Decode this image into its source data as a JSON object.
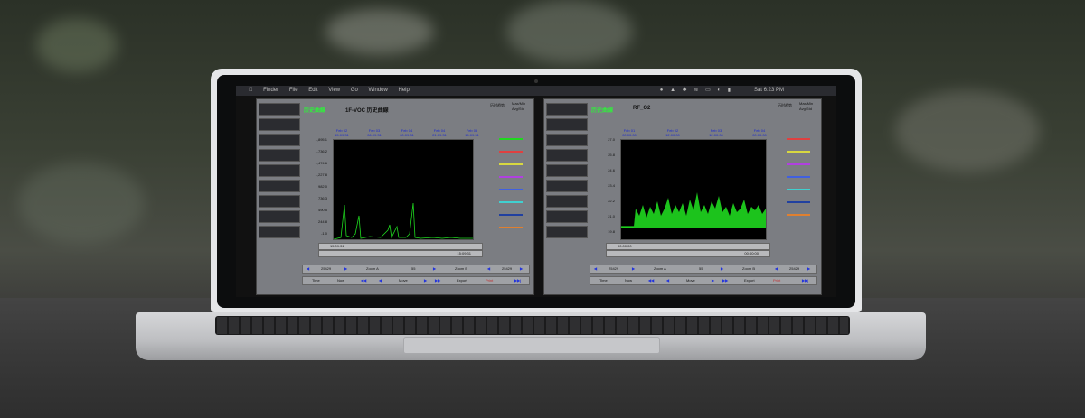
{
  "menubar": {
    "app": "Finder",
    "items": [
      "File",
      "Edit",
      "View",
      "Go",
      "Window",
      "Help"
    ],
    "clock": "Sat 6:23 PM"
  },
  "window_left": {
    "title_cn": "历史曲線",
    "title": "1F-VOC 历史曲線",
    "option_1": "历时趋势",
    "option_2": "Max/Min",
    "option_3": "Avg/Std",
    "dates": [
      "Feb 02\n15:09:31",
      "Feb 03\n06:09:31",
      "Feb 04\n00:09:31",
      "Feb 04\n21:09:31",
      "Feb 05\n15:09:31"
    ],
    "yticks": [
      "1,895.1",
      "1,736.2",
      "1,474.6",
      "1,227.8",
      "982.0",
      "736.3",
      "490.5",
      "244.8",
      "-1.0"
    ],
    "scroll_time_left": "15:09:31",
    "scroll_time_right": "15:09:31",
    "nav": {
      "left_val": "25429",
      "zoom_a": "Zoom A",
      "mid": "55",
      "zoom_b": "Zoom B",
      "right_val": "25429"
    },
    "buttons": {
      "b1": "Time",
      "b2": "Now",
      "b3": "Move",
      "b4": "Export",
      "b5": "Print"
    }
  },
  "window_right": {
    "title_cn": "历史曲線",
    "title": "RF_O2",
    "option_1": "历时趋势",
    "option_2": "Max/Min",
    "option_3": "Avg/Std",
    "dates": [
      "Feb 01\n00:00:00",
      "Feb 02\n12:00:00",
      "Feb 03\n12:00:00",
      "Feb 04\n00:00:00"
    ],
    "yticks": [
      "27.0",
      "25.8",
      "24.6",
      "23.4",
      "22.2",
      "21.0",
      "19.8"
    ],
    "scroll_time_left": "00:00:00",
    "scroll_time_right": "00:00:00",
    "nav": {
      "left_val": "25429",
      "zoom_a": "Zoom A",
      "mid": "55",
      "zoom_b": "Zoom B",
      "right_val": "25429"
    },
    "buttons": {
      "b1": "Time",
      "b2": "Now",
      "b3": "Move",
      "b4": "Export",
      "b5": "Print"
    }
  },
  "colors": {
    "trend": "#1fd81f",
    "date_text": "#1a28d0",
    "window_bg": "#7b7d82"
  }
}
